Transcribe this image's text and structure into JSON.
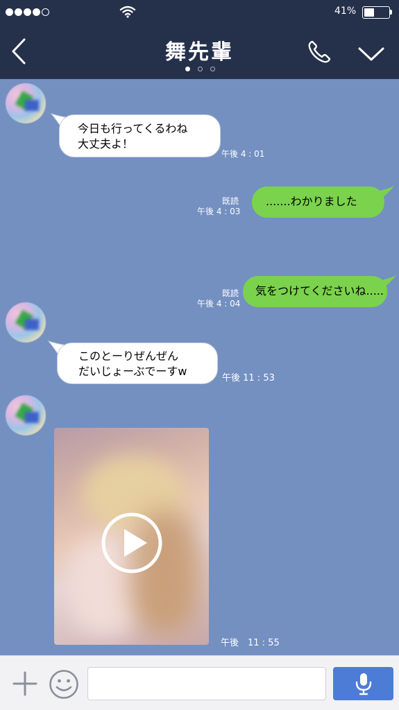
{
  "status": {
    "signal_bars": 5,
    "signal_filled": 4,
    "battery_text": "41%",
    "battery_level": 0.41
  },
  "header": {
    "title": "舞先輩",
    "pages": 3,
    "active_page": 0
  },
  "messages": [
    {
      "side": "left",
      "lines": [
        "今日も行ってくるわね",
        "大丈夫よ！"
      ],
      "time": "午後 4 : 01"
    },
    {
      "side": "right",
      "text": ".......わかりました",
      "read": "既読",
      "time": "午後 4 : 03"
    },
    {
      "side": "right",
      "text": "気をつけてくださいね.....",
      "read": "既読",
      "time": "午後 4 : 04"
    },
    {
      "side": "left",
      "lines": [
        "このとーりぜんぜん",
        "だいじょーぶでーすw"
      ],
      "time": "午後 11 : 53"
    },
    {
      "side": "left",
      "type": "video",
      "time": "午後　11 : 55"
    }
  ],
  "input": {
    "value": "",
    "placeholder": ""
  },
  "colors": {
    "header_bg": "#25304a",
    "chat_bg": "#7390c1",
    "outgoing_bubble": "#7bd24c",
    "incoming_bubble": "#ffffff",
    "mic_button": "#4d7cd6"
  },
  "icons": {
    "back": "chevron-left-icon",
    "call": "phone-icon",
    "menu": "chevron-down-icon",
    "attach": "plus-icon",
    "sticker": "smiley-icon",
    "voice": "microphone-icon",
    "wifi": "wifi-icon",
    "play": "play-icon"
  }
}
